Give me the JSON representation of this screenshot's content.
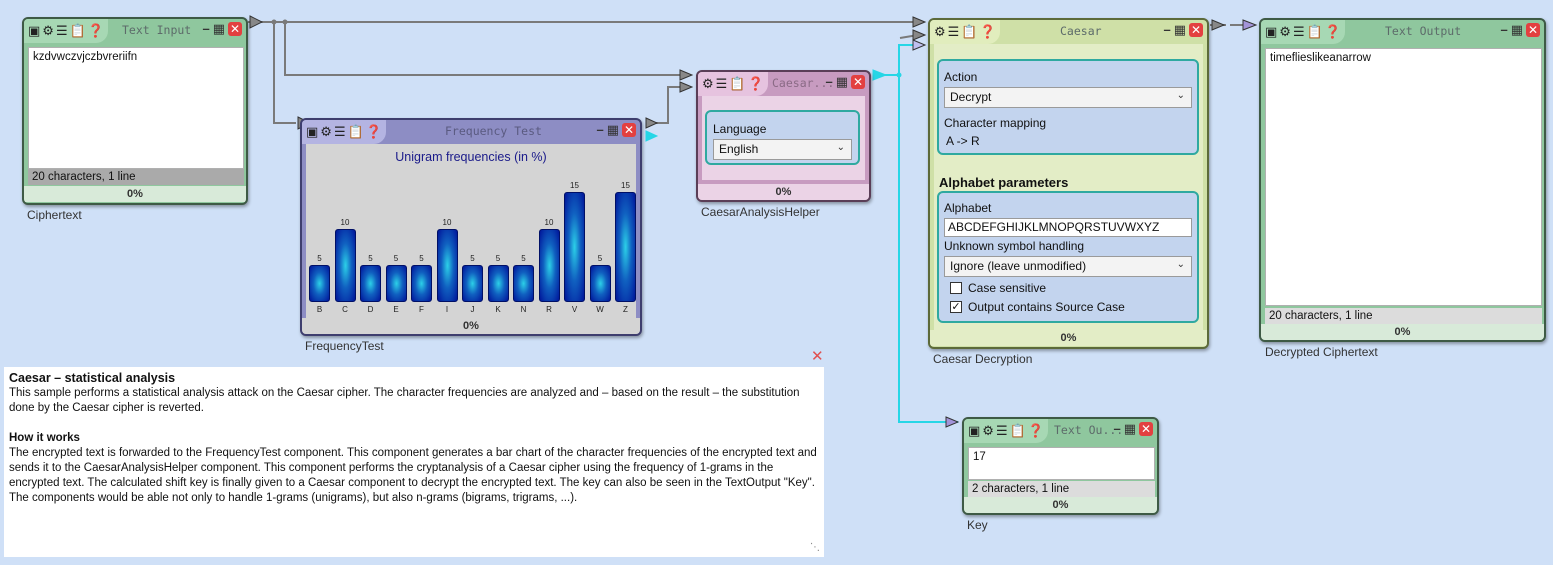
{
  "text_input": {
    "title": "Text Input",
    "value": "kzdvwczvjczbvreriifn",
    "status": "20 characters,  1 line",
    "progress": "0%",
    "caption": "Ciphertext"
  },
  "frequency_test": {
    "title": "Frequency Test",
    "chart_title": "Unigram frequencies (in %)",
    "progress": "0%",
    "caption": "FrequencyTest"
  },
  "chart_data": {
    "type": "bar",
    "title": "Unigram frequencies (in %)",
    "categories": [
      "B",
      "C",
      "D",
      "E",
      "F",
      "I",
      "J",
      "K",
      "N",
      "R",
      "V",
      "W",
      "Z"
    ],
    "values": [
      5,
      10,
      5,
      5,
      5,
      10,
      5,
      5,
      5,
      10,
      15,
      5,
      15
    ],
    "ylim": [
      0,
      15
    ]
  },
  "helper": {
    "title": "Caesar...",
    "language_label": "Language",
    "language_value": "English",
    "progress": "0%",
    "caption": "CaesarAnalysisHelper"
  },
  "caesar": {
    "title": "Caesar",
    "action_label": "Action",
    "action_value": "Decrypt",
    "mapping_label": "Character mapping",
    "mapping_value": "A -> R",
    "alphabet_section": "Alphabet parameters",
    "alphabet_label": "Alphabet",
    "alphabet_value": "ABCDEFGHIJKLMNOPQRSTUVWXYZ",
    "unknown_label": "Unknown symbol handling",
    "unknown_value": "Ignore (leave unmodified)",
    "case_sensitive_label": "Case sensitive",
    "case_sensitive_checked": false,
    "source_case_label": "Output contains Source Case",
    "source_case_checked": true,
    "progress": "0%",
    "caption": "Caesar Decryption"
  },
  "text_output": {
    "title": "Text Output",
    "value": "timeflieslikeanarrow",
    "status": "20 characters,  1 line",
    "progress": "0%",
    "caption": "Decrypted Ciphertext"
  },
  "key_output": {
    "title": "Text Ou...",
    "value": "17",
    "status": "2 characters,  1 line",
    "progress": "0%",
    "caption": "Key"
  },
  "info": {
    "heading": "Caesar – statistical analysis",
    "intro": "This sample performs a statistical analysis attack on the Caesar cipher. The character frequencies are analyzed and – based on the result – the substitution done by the Caesar cipher is reverted.",
    "how_heading": "How it works",
    "how_text": "The encrypted text is forwarded to the FrequencyTest component. This component generates a bar chart of the character frequencies of the encrypted text and sends it to the CaesarAnalysisHelper component. This component performs the cryptanalysis of a Caesar cipher using the frequency of 1-grams in the encrypted text. The calculated shift key is finally given to a Caesar component to decrypt the encrypted text. The key can also be seen in the TextOutput \"Key\".",
    "closing": "The components would be able not only to handle 1-grams (unigrams), but also n-grams (bigrams, trigrams, ...)."
  },
  "colors": {
    "canvas": "#cfe0f7",
    "wire_gray": "#7a7a7a",
    "wire_cyan": "#26d6e6",
    "close_red": "#e34040",
    "panel_border": "#2fa9a0"
  }
}
